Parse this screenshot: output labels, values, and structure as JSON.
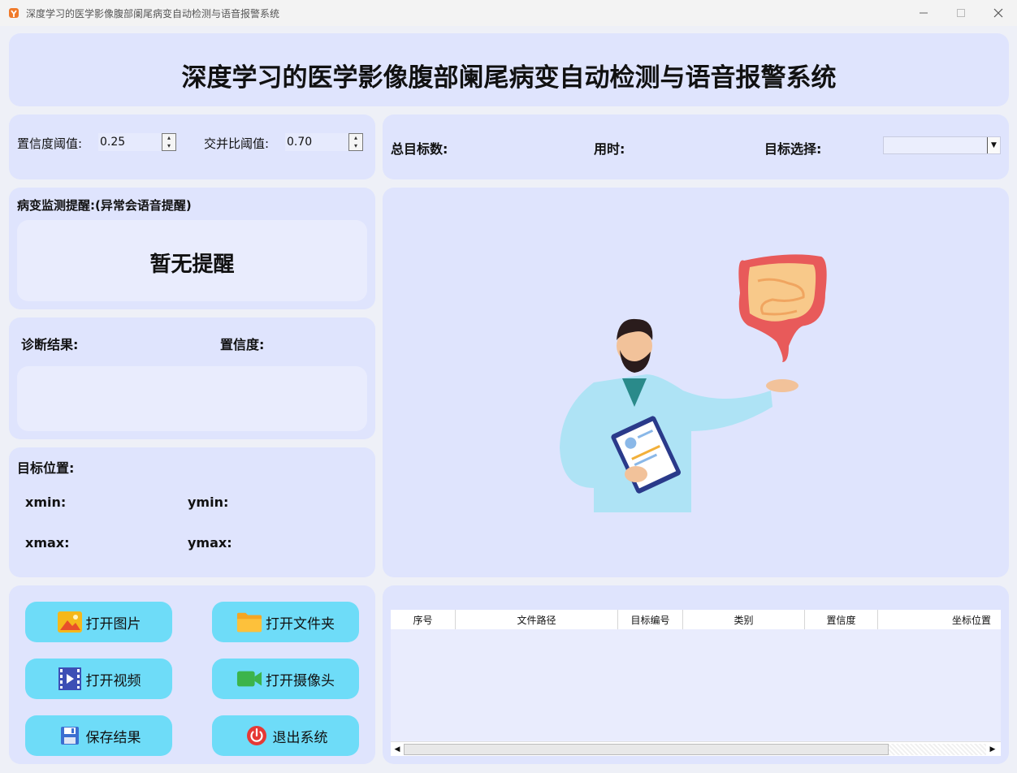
{
  "window": {
    "title": "深度学习的医学影像腹部阑尾病变自动检测与语音报警系统",
    "minimize_icon": "minimize-icon",
    "maximize_icon": "maximize-icon",
    "close_icon": "close-icon"
  },
  "header": {
    "title": "深度学习的医学影像腹部阑尾病变自动检测与语音报警系统"
  },
  "thresholds": {
    "conf_label": "置信度阈值:",
    "conf_value": "0.25",
    "iou_label": "交并比阈值:",
    "iou_value": "0.70"
  },
  "stats": {
    "total_label": "总目标数:",
    "time_label": "用时:",
    "select_label": "目标选择:",
    "select_value": ""
  },
  "alert": {
    "label": "病变监测提醒:(异常会语音提醒)",
    "message": "暂无提醒"
  },
  "diagnosis": {
    "result_label": "诊断结果:",
    "confidence_label": "置信度:"
  },
  "position": {
    "label": "目标位置:",
    "xmin": "xmin:",
    "ymin": "ymin:",
    "xmax": "xmax:",
    "ymax": "ymax:"
  },
  "buttons": {
    "open_image": "打开图片",
    "open_folder": "打开文件夹",
    "open_video": "打开视频",
    "open_camera": "打开摄像头",
    "save_result": "保存结果",
    "exit_system": "退出系统"
  },
  "table": {
    "headers": [
      "序号",
      "文件路径",
      "目标编号",
      "类别",
      "置信度",
      "坐标位置"
    ],
    "rows": []
  },
  "colors": {
    "panel": "#dfe4fd",
    "button": "#6edcf8",
    "background": "#eef0f7"
  }
}
